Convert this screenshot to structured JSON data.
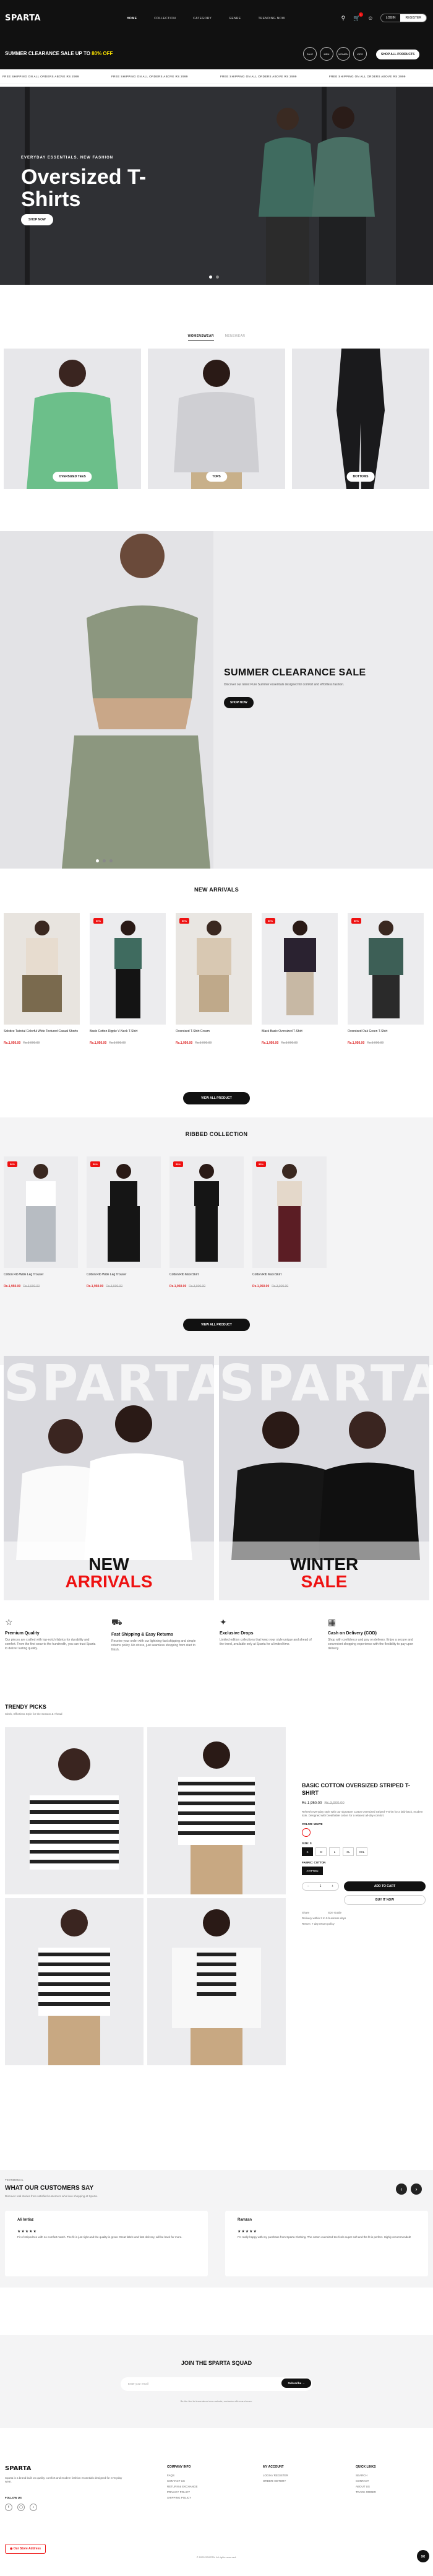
{
  "header": {
    "logo": "SPARTA",
    "nav": [
      "HOME",
      "COLLECTION",
      "CATEGORY",
      "GENRE",
      "TRENDING NOW"
    ],
    "login": "LOGIN",
    "register": "REGISTER",
    "cart_count": "1"
  },
  "promo": {
    "lead": "SUMMER CLEARANCE SALE UP TO ",
    "highlight": "80% OFF",
    "circle_labels": [
      "SALE",
      "MEN",
      "WOMEN",
      "KIDS"
    ],
    "shop_btn": "SHOP ALL PRODUCTS"
  },
  "ticker": [
    "FREE SHIPPING ON ALL ORDERS ABOVE RS 2999",
    "FREE SHIPPING ON ALL ORDERS ABOVE RS 2999",
    "FREE SHIPPING ON ALL ORDERS ABOVE RS 2999",
    "FREE SHIPPING ON ALL ORDERS ABOVE RS 2999"
  ],
  "hero": {
    "sub": "EVERYDAY ESSENTIALS. NEW FASHION",
    "title": "Oversized T-Shirts",
    "button": "SHOP NOW"
  },
  "category_tabs": [
    "WOMENSWEAR",
    "MENSWEAR"
  ],
  "categories": [
    "OVERSIZED TEES",
    "TOPS",
    "BOTTOMS"
  ],
  "clearance": {
    "title": "SUMMER CLEARANCE SALE",
    "text": "Discover our latest Pure Summer essentials designed for comfort and effortless fashion.",
    "button": "SHOP NOW"
  },
  "new_arrivals": {
    "title": "NEW ARRIVALS",
    "view_all": "VIEW ALL PRODUCT",
    "products": [
      {
        "name": "Solstice Tutorial Colorful Wide Textured Casual Shorts",
        "price": "Rs.1,950.00",
        "old": "Rs.3,900.00",
        "badge": ""
      },
      {
        "name": "Basic Cotton Ripple V-Neck T-Shirt",
        "price": "Rs.1,950.00",
        "old": "Rs.3,900.00",
        "badge": "50%"
      },
      {
        "name": "Oversized T-Shirt Cream",
        "price": "Rs.1,950.00",
        "old": "Rs.3,900.00",
        "badge": "50%"
      },
      {
        "name": "Black Basic Oversized T-Shirt",
        "price": "Rs.1,950.00",
        "old": "Rs.3,900.00",
        "badge": "50%"
      },
      {
        "name": "Oversized Oak Green T-Shirt",
        "price": "Rs.1,950.00",
        "old": "Rs.3,900.00",
        "badge": "50%"
      }
    ]
  },
  "ribbed": {
    "title": "RIBBED COLLECTION",
    "view_all": "VIEW ALL PRODUCT",
    "products": [
      {
        "name": "Cotton Rib Wide Leg Trouser",
        "price": "Rs.1,950.00",
        "old": "Rs.3,900.00",
        "badge": "50%"
      },
      {
        "name": "Cotton Rib Wide Leg Trouser",
        "price": "Rs.1,950.00",
        "old": "Rs.3,900.00",
        "badge": "50%"
      },
      {
        "name": "Cotton Rib Maxi Skirt",
        "price": "Rs.1,950.00",
        "old": "Rs.3,900.00",
        "badge": "50%"
      },
      {
        "name": "Cotton Rib Maxi Skirt",
        "price": "Rs.1,950.00",
        "old": "Rs.3,900.00",
        "badge": "50%"
      }
    ]
  },
  "banners": {
    "word": "SPARTA",
    "left": {
      "line1": "NEW",
      "line2": "ARRIVALS"
    },
    "right": {
      "line1": "WINTER",
      "line2": "SALE"
    }
  },
  "features": [
    {
      "icon": "badge-icon",
      "title": "Premium Quality",
      "text": "Our pieces are crafted with top-notch fabrics for durability and comfort. From the first wear to the hundredth, you can trust Sparta to deliver lasting quality."
    },
    {
      "icon": "truck-icon",
      "title": "Fast Shipping & Easy Returns",
      "text": "Receive your order with our lightning-fast shipping and simple returns policy. No stress, just seamless shopping from start to finish."
    },
    {
      "icon": "sparkle-icon",
      "title": "Exclusive Drops",
      "text": "Limited edition collections that keep your style unique and ahead of the trend, available only at Sparta for a limited time."
    },
    {
      "icon": "cash-icon",
      "title": "Cash on Delivery (COD)",
      "text": "Shop with confidence and pay on delivery. Enjoy a secure and convenient shopping experience with the flexibility to pay upon delivery."
    }
  ],
  "trendy": {
    "title": "TRENDY PICKS",
    "subtitle": "Sleek, Effortless Style for the Season & Ahead",
    "product": {
      "title": "BASIC COTTON OVERSIZED STRIPED T-SHIRT",
      "price": "Rs.1,950.00",
      "old": "Rs.3,900.00",
      "desc": "Refresh everyday style with our signature Cotton Oversized Striped T-Shirt for a laid-back, modern look. Designed with breathable cotton for a relaxed all-day comfort.",
      "color_label": "COLOR: WHITE",
      "size_label": "SIZE: S",
      "sizes": [
        "S",
        "M",
        "L",
        "XL",
        "XXL"
      ],
      "fabric_label": "FABRIC: COTTON",
      "fabric": "COTTON",
      "qty": "1",
      "add_cart": "ADD TO CART",
      "buy_now": "BUY IT NOW",
      "meta": [
        "Share",
        "Size Guide",
        "Delivery within 3 to 5 business days",
        "Return: 7 day return policy"
      ]
    }
  },
  "testimonials": {
    "kicker": "TESTIMONIAL",
    "title": "WHAT OUR CUSTOMERS SAY",
    "sub": "Discover real stories from satisfied customers who love shopping at Sparta.",
    "items": [
      {
        "name": "Ali Imtiaz",
        "stars": "★★★★★",
        "text": "Fit of striped tee with no comfort match. The fit is just right and the quality is great. Great fabric and fast delivery, will be back for more."
      },
      {
        "name": "Ramzan",
        "stars": "★★★★★",
        "text": "I'm really happy with my purchase from Sparta Clothing. The cotton oversized tee feels super soft and the fit is perfect. Highly recommended!"
      }
    ]
  },
  "newsletter": {
    "title": "JOIN THE SPARTA SQUAD",
    "placeholder": "Enter your email",
    "button": "Subscribe",
    "note": "Be the first to know about new arrivals, exclusive offers and more."
  },
  "footer": {
    "logo": "SPARTA",
    "desc": "Sparta is a brand built on quality, comfort and modern fashion essentials designed for everyday wear.",
    "follow": "FOLLOW US",
    "cols": [
      {
        "title": "COMPANY INFO",
        "items": [
          "FAQS",
          "CONTACT US",
          "RETURN & EXCHANGE",
          "PRIVACY POLICY",
          "SHIPPING POLICY"
        ]
      },
      {
        "title": "MY ACCOUNT",
        "items": [
          "LOGIN / REGISTER",
          "ORDER HISTORY"
        ]
      },
      {
        "title": "QUICK LINKS",
        "items": [
          "SEARCH",
          "CONTACT",
          "ABOUT US",
          "TRACK ORDER"
        ]
      }
    ],
    "store_btn": "Our Store Address",
    "copyright": "© 2025 SPARTA. All rights reserved."
  }
}
